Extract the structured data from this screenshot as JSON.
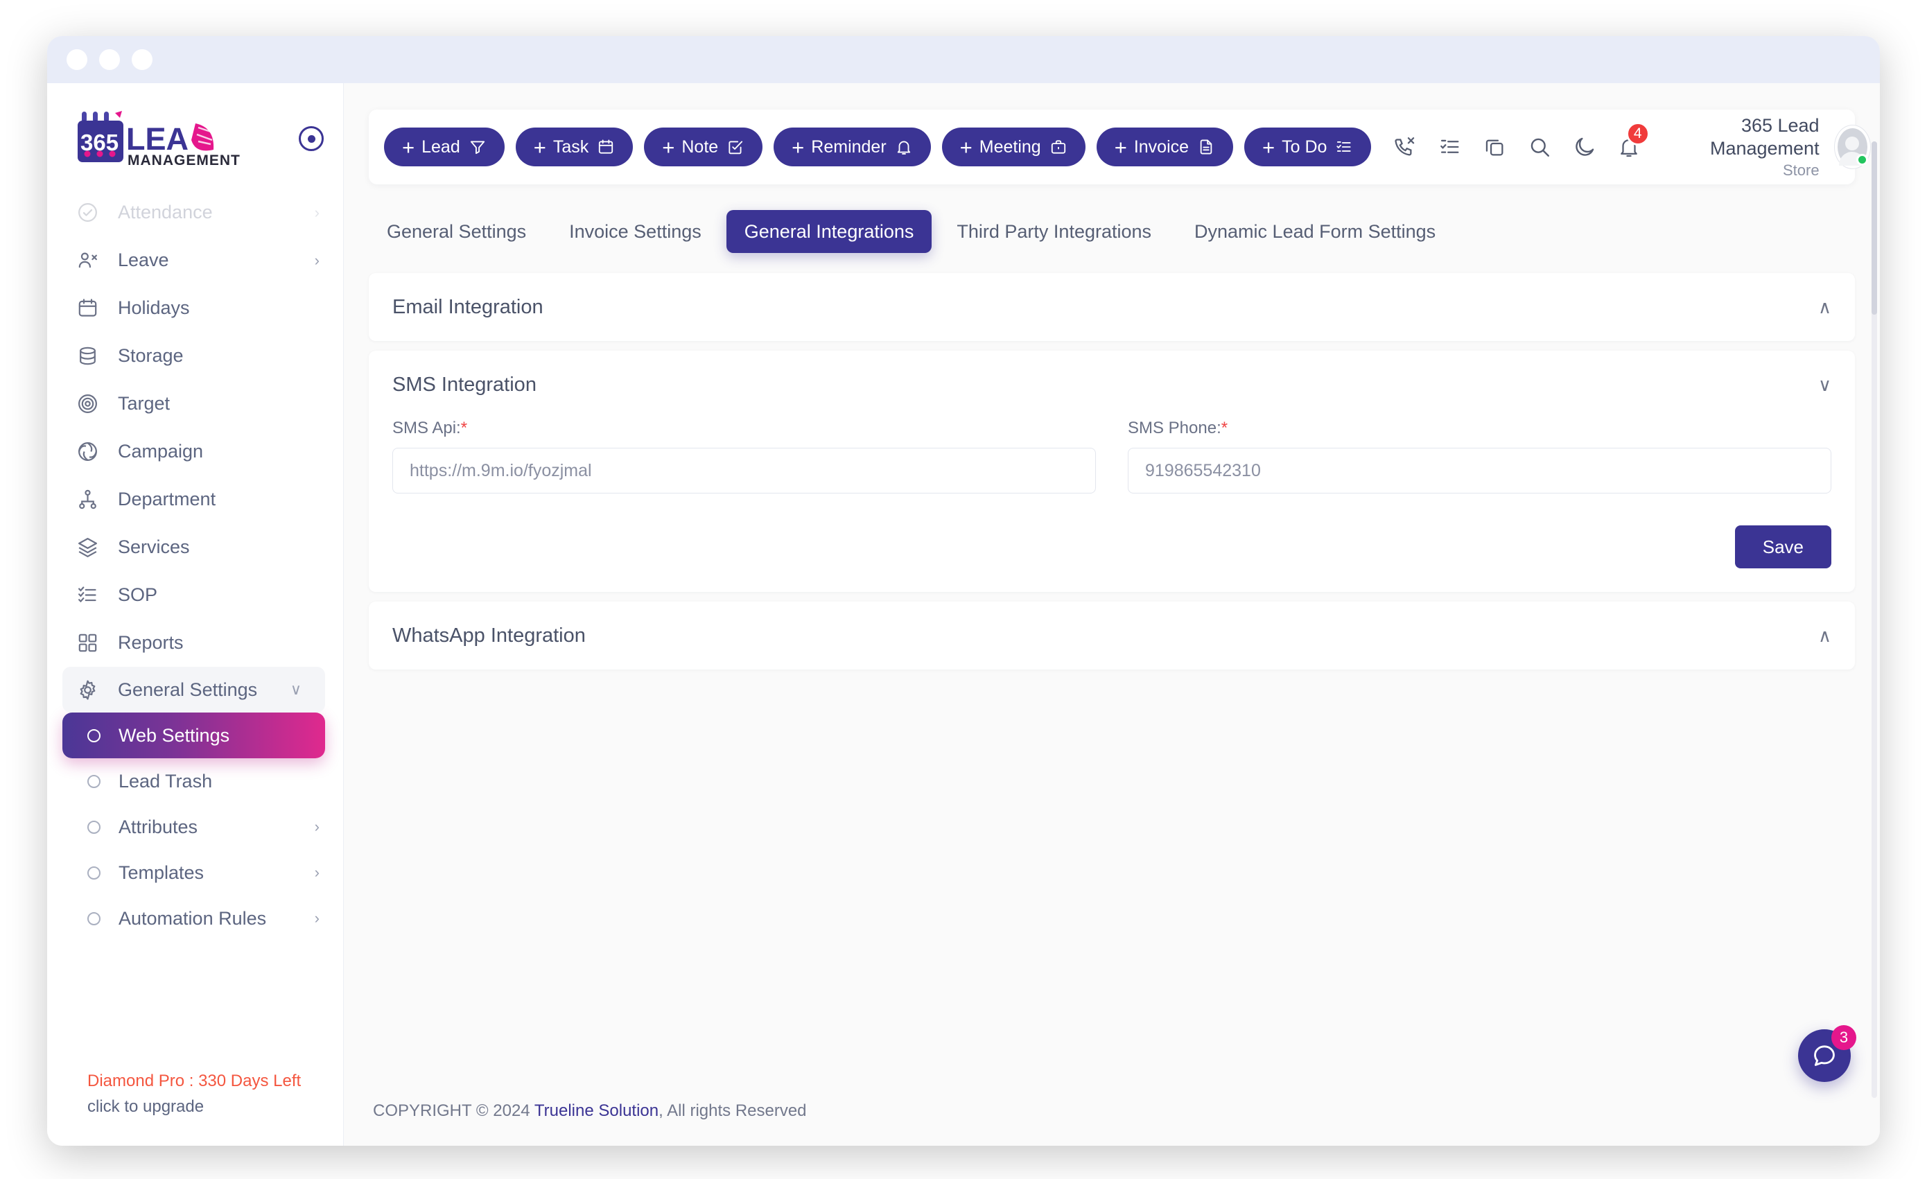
{
  "window": {
    "dots": [
      "close",
      "minimize",
      "maximize"
    ]
  },
  "brand": {
    "logo_number": "365",
    "logo_word": "LEAD",
    "logo_sub": "MANAGEMENT",
    "collapse_icon": "circle-dot-icon"
  },
  "sidebar": {
    "items": [
      {
        "label": "Attendance",
        "icon": "check-circle-icon",
        "chevron": "›",
        "disabled": true
      },
      {
        "label": "Leave",
        "icon": "user-minus-icon",
        "chevron": "›",
        "disabled": false
      },
      {
        "label": "Holidays",
        "icon": "calendar-icon",
        "chevron": "",
        "disabled": false
      },
      {
        "label": "Storage",
        "icon": "database-icon",
        "chevron": "",
        "disabled": false
      },
      {
        "label": "Target",
        "icon": "target-icon",
        "chevron": "",
        "disabled": false
      },
      {
        "label": "Campaign",
        "icon": "campaign-icon",
        "chevron": "",
        "disabled": false
      },
      {
        "label": "Department",
        "icon": "sitemap-icon",
        "chevron": "",
        "disabled": false
      },
      {
        "label": "Services",
        "icon": "layers-icon",
        "chevron": "",
        "disabled": false
      },
      {
        "label": "SOP",
        "icon": "checklist-icon",
        "chevron": "",
        "disabled": false
      },
      {
        "label": "Reports",
        "icon": "grid-icon",
        "chevron": "",
        "disabled": false
      }
    ],
    "group": {
      "label": "General Settings",
      "icon": "gear-icon",
      "chevron": "∨"
    },
    "subitems": [
      {
        "label": "Web Settings",
        "chevron": "",
        "active": true
      },
      {
        "label": "Lead Trash",
        "chevron": "",
        "active": false
      },
      {
        "label": "Attributes",
        "chevron": "›",
        "active": false
      },
      {
        "label": "Templates",
        "chevron": "›",
        "active": false
      },
      {
        "label": "Automation Rules",
        "chevron": "›",
        "active": false
      }
    ],
    "license": {
      "plan": "Diamond Pro : 330 Days Left",
      "upgrade": "click to upgrade"
    }
  },
  "toolbar": {
    "buttons": [
      {
        "label": "Lead",
        "icon": "filter-icon"
      },
      {
        "label": "Task",
        "icon": "calendar-icon"
      },
      {
        "label": "Note",
        "icon": "note-check-icon"
      },
      {
        "label": "Reminder",
        "icon": "bell-icon"
      },
      {
        "label": "Meeting",
        "icon": "briefcase-icon"
      },
      {
        "label": "Invoice",
        "icon": "document-icon"
      },
      {
        "label": "To Do",
        "icon": "todo-list-icon"
      }
    ],
    "plus": "+"
  },
  "header": {
    "icons": [
      {
        "name": "missed-call-icon"
      },
      {
        "name": "task-list-icon"
      },
      {
        "name": "copy-icon"
      },
      {
        "name": "search-icon"
      },
      {
        "name": "dark-mode-moon-icon"
      },
      {
        "name": "notification-bell-icon"
      }
    ],
    "notification_count": "4",
    "account_name": "365 Lead Management",
    "account_role": "Store",
    "avatar": "user-avatar"
  },
  "tabs": [
    {
      "label": "General Settings",
      "active": false
    },
    {
      "label": "Invoice Settings",
      "active": false
    },
    {
      "label": "General Integrations",
      "active": true
    },
    {
      "label": "Third Party Integrations",
      "active": false
    },
    {
      "label": "Dynamic Lead Form Settings",
      "active": false
    }
  ],
  "panels": {
    "email": {
      "title": "Email Integration",
      "chevron": "∧",
      "expanded": false
    },
    "sms": {
      "title": "SMS Integration",
      "chevron": "∨",
      "expanded": true,
      "fields": [
        {
          "label": "SMS Api:",
          "required": "*",
          "value": "https://m.9m.io/fyozjmal",
          "placeholder": "https://m.9m.io/fyozjmal"
        },
        {
          "label": "SMS Phone:",
          "required": "*",
          "value": "919865542310",
          "placeholder": "919865542310"
        }
      ],
      "save_label": "Save"
    },
    "whatsapp": {
      "title": "WhatsApp Integration",
      "chevron": "∧",
      "expanded": false
    }
  },
  "footer": {
    "prefix": "COPYRIGHT © 2024 ",
    "link": "Trueline Solution",
    "suffix": ", All rights Reserved"
  },
  "chat": {
    "icon": "chat-bubble-icon",
    "badge": "3"
  }
}
